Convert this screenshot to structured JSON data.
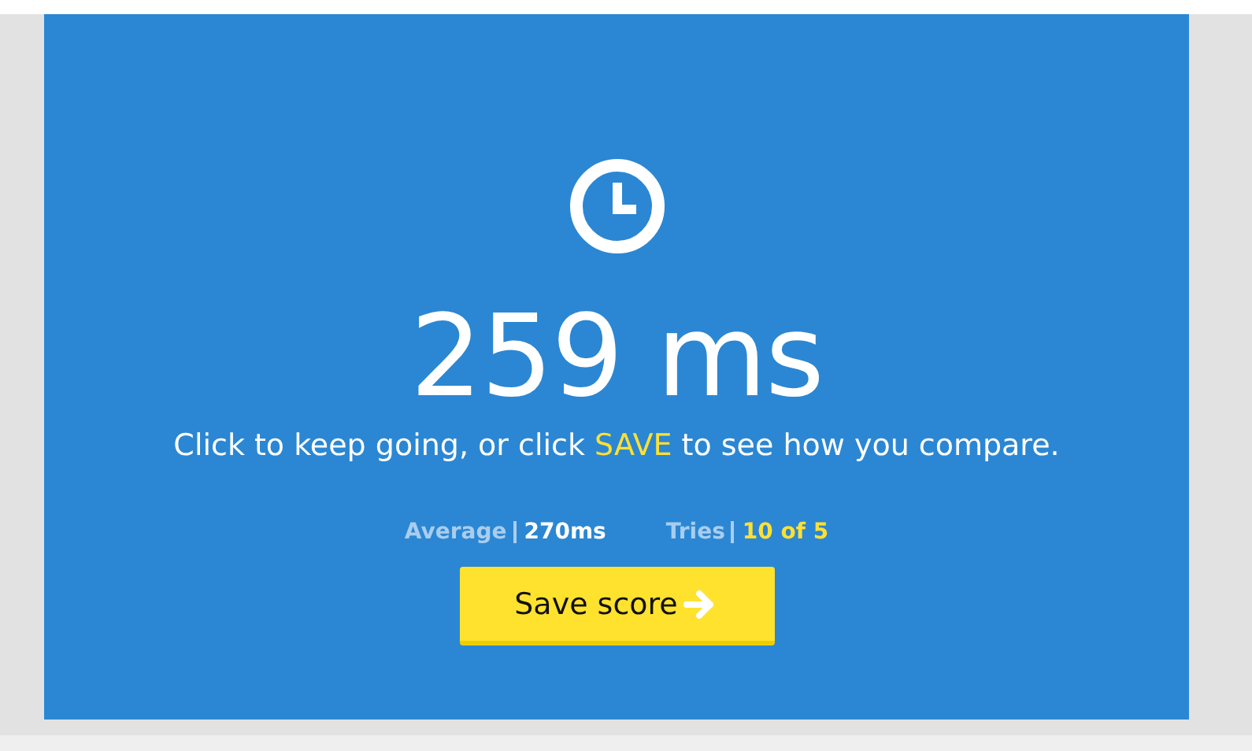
{
  "result": {
    "time": "259 ms",
    "message": {
      "before": "Click to keep going, or click ",
      "highlight": "SAVE",
      "after": " to see how you compare."
    },
    "stats": [
      {
        "label": "Average",
        "value": "270ms",
        "color": "#ffffff"
      },
      {
        "label": "Tries",
        "value": "10 of 5",
        "color": "#ffe033"
      }
    ],
    "button": "Save score"
  }
}
